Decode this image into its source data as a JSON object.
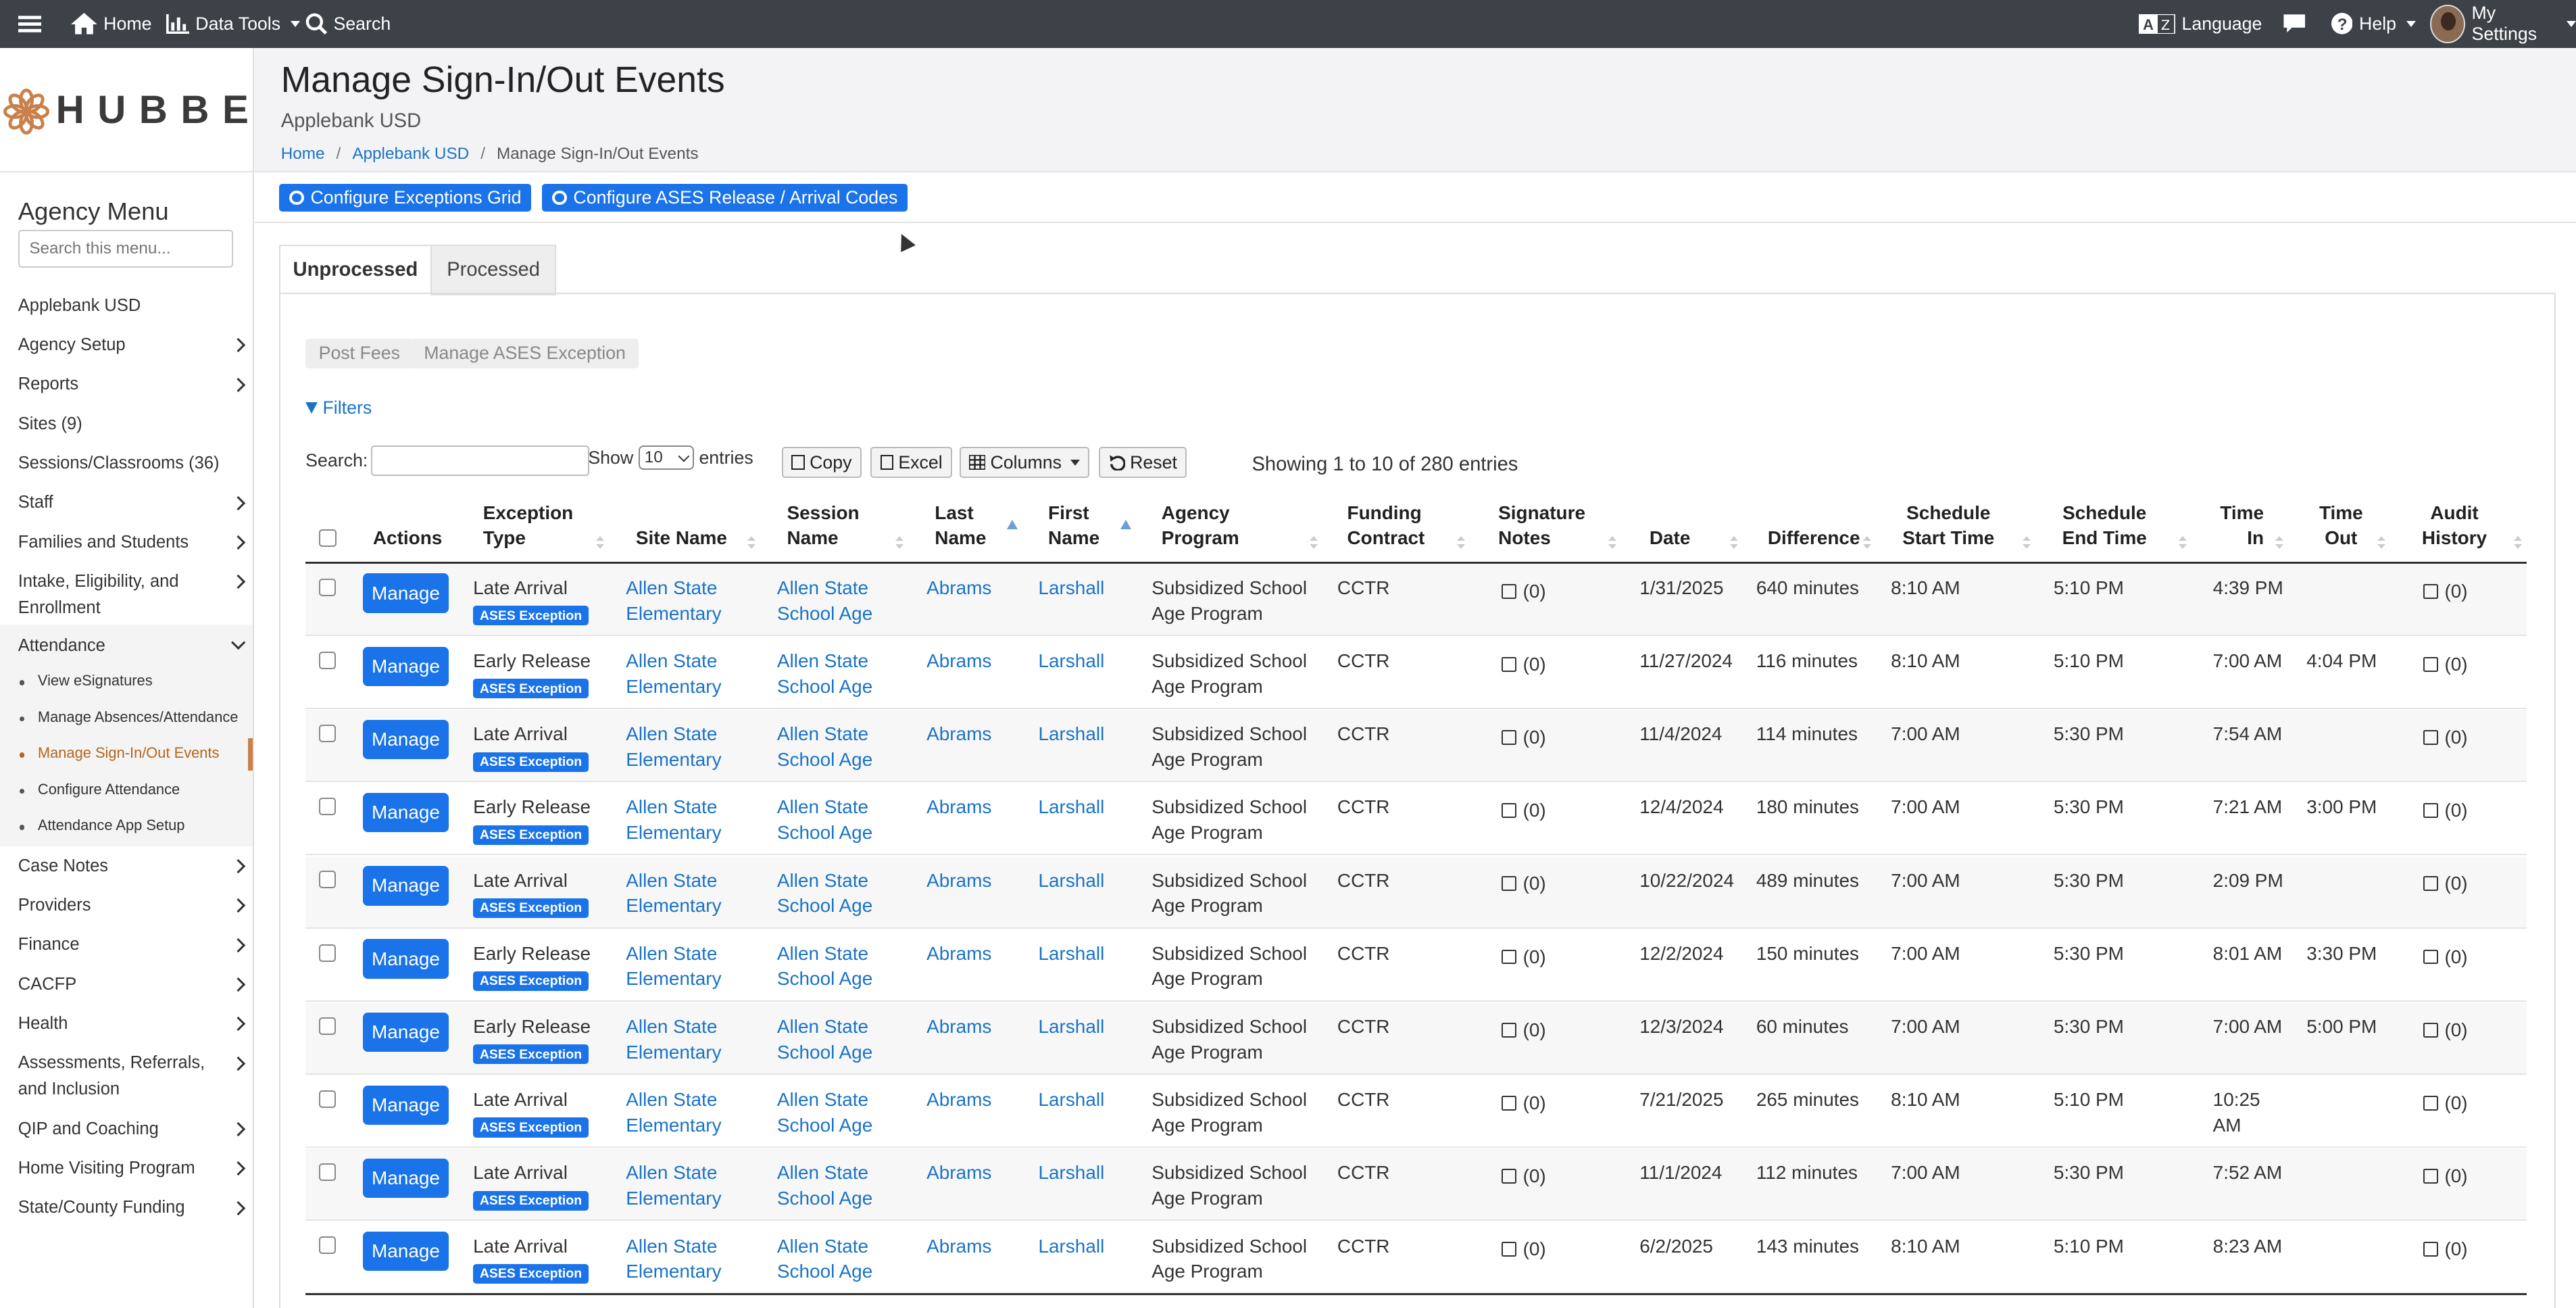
{
  "topnav": {
    "home": "Home",
    "data_tools": "Data Tools",
    "search": "Search",
    "language": "Language",
    "help": "Help",
    "settings": "My Settings"
  },
  "logo": "HUBBE",
  "sidebar": {
    "title": "Agency Menu",
    "search_placeholder": "Search this menu...",
    "items": [
      "Applebank USD",
      "Agency Setup",
      "Reports",
      "Sites (9)",
      "Sessions/Classrooms (36)",
      "Staff",
      "Families and Students",
      "Intake, Eligibility, and Enrollment",
      "Attendance",
      "Case Notes",
      "Providers",
      "Finance",
      "CACFP",
      "Health",
      "Assessments, Referrals, and Inclusion",
      "QIP and Coaching",
      "Home Visiting Program",
      "State/County Funding"
    ],
    "attendance_sub": [
      "View eSignatures",
      "Manage Absences/Attendance",
      "Manage Sign-In/Out Events",
      "Configure Attendance",
      "Attendance App Setup"
    ]
  },
  "page": {
    "title": "Manage Sign-In/Out Events",
    "subtitle": "Applebank USD",
    "breadcrumb": [
      "Home",
      "Applebank USD",
      "Manage Sign-In/Out Events"
    ],
    "btn_exceptions": "Configure Exceptions Grid",
    "btn_ases": "Configure ASES Release / Arrival Codes"
  },
  "tabs": [
    "Unprocessed",
    "Processed"
  ],
  "actions": {
    "post_fees": "Post Fees",
    "manage_ases": "Manage ASES Exception",
    "filters": "Filters"
  },
  "table_controls": {
    "search_label": "Search:",
    "show_label": "Show",
    "show_value": "10",
    "entries_label": "entries",
    "copy": "Copy",
    "excel": "Excel",
    "columns": "Columns",
    "reset": "Reset",
    "info": "Showing 1 to 10 of 280 entries"
  },
  "columns": [
    "Actions",
    "Exception Type",
    "Site Name",
    "Session Name",
    "Last Name",
    "First Name",
    "Agency Program",
    "Funding Contract",
    "Signature Notes",
    "Date",
    "Difference",
    "Schedule Start Time",
    "Schedule End Time",
    "Time In",
    "Time Out",
    "Audit History"
  ],
  "rows": [
    {
      "type": "Late Arrival",
      "badge": "ASES Exception",
      "site": [
        "Allen State",
        "Elementary"
      ],
      "session": [
        "Allen State",
        "School Age"
      ],
      "last": "Abrams",
      "first": "Larshall",
      "program": [
        "Subsidized School",
        "Age Program"
      ],
      "contract": "CCTR",
      "notes": "(0)",
      "date": "1/31/2025",
      "diff": "640 minutes",
      "start": "8:10 AM",
      "end": "5:10 PM",
      "in": "4:39 PM",
      "out": "",
      "audit": "(0)"
    },
    {
      "type": "Early Release",
      "badge": "ASES Exception",
      "site": [
        "Allen State",
        "Elementary"
      ],
      "session": [
        "Allen State",
        "School Age"
      ],
      "last": "Abrams",
      "first": "Larshall",
      "program": [
        "Subsidized School",
        "Age Program"
      ],
      "contract": "CCTR",
      "notes": "(0)",
      "date": "11/27/2024",
      "diff": "116 minutes",
      "start": "8:10 AM",
      "end": "5:10 PM",
      "in": "7:00 AM",
      "out": "4:04 PM",
      "audit": "(0)"
    },
    {
      "type": "Late Arrival",
      "badge": "ASES Exception",
      "site": [
        "Allen State",
        "Elementary"
      ],
      "session": [
        "Allen State",
        "School Age"
      ],
      "last": "Abrams",
      "first": "Larshall",
      "program": [
        "Subsidized School",
        "Age Program"
      ],
      "contract": "CCTR",
      "notes": "(0)",
      "date": "11/4/2024",
      "diff": "114 minutes",
      "start": "7:00 AM",
      "end": "5:30 PM",
      "in": "7:54 AM",
      "out": "",
      "audit": "(0)"
    },
    {
      "type": "Early Release",
      "badge": "ASES Exception",
      "site": [
        "Allen State",
        "Elementary"
      ],
      "session": [
        "Allen State",
        "School Age"
      ],
      "last": "Abrams",
      "first": "Larshall",
      "program": [
        "Subsidized School",
        "Age Program"
      ],
      "contract": "CCTR",
      "notes": "(0)",
      "date": "12/4/2024",
      "diff": "180 minutes",
      "start": "7:00 AM",
      "end": "5:30 PM",
      "in": "7:21 AM",
      "out": "3:00 PM",
      "audit": "(0)"
    },
    {
      "type": "Late Arrival",
      "badge": "ASES Exception",
      "site": [
        "Allen State",
        "Elementary"
      ],
      "session": [
        "Allen State",
        "School Age"
      ],
      "last": "Abrams",
      "first": "Larshall",
      "program": [
        "Subsidized School",
        "Age Program"
      ],
      "contract": "CCTR",
      "notes": "(0)",
      "date": "10/22/2024",
      "diff": "489 minutes",
      "start": "7:00 AM",
      "end": "5:30 PM",
      "in": "2:09 PM",
      "out": "",
      "audit": "(0)"
    },
    {
      "type": "Early Release",
      "badge": "ASES Exception",
      "site": [
        "Allen State",
        "Elementary"
      ],
      "session": [
        "Allen State",
        "School Age"
      ],
      "last": "Abrams",
      "first": "Larshall",
      "program": [
        "Subsidized School",
        "Age Program"
      ],
      "contract": "CCTR",
      "notes": "(0)",
      "date": "12/2/2024",
      "diff": "150 minutes",
      "start": "7:00 AM",
      "end": "5:30 PM",
      "in": "8:01 AM",
      "out": "3:30 PM",
      "audit": "(0)"
    },
    {
      "type": "Early Release",
      "badge": "ASES Exception",
      "site": [
        "Allen State",
        "Elementary"
      ],
      "session": [
        "Allen State",
        "School Age"
      ],
      "last": "Abrams",
      "first": "Larshall",
      "program": [
        "Subsidized School",
        "Age Program"
      ],
      "contract": "CCTR",
      "notes": "(0)",
      "date": "12/3/2024",
      "diff": "60 minutes",
      "start": "7:00 AM",
      "end": "5:30 PM",
      "in": "7:00 AM",
      "out": "5:00 PM",
      "audit": "(0)"
    },
    {
      "type": "Late Arrival",
      "badge": "ASES Exception",
      "site": [
        "Allen State",
        "Elementary"
      ],
      "session": [
        "Allen State",
        "School Age"
      ],
      "last": "Abrams",
      "first": "Larshall",
      "program": [
        "Subsidized School",
        "Age Program"
      ],
      "contract": "CCTR",
      "notes": "(0)",
      "date": "7/21/2025",
      "diff": "265 minutes",
      "start": "8:10 AM",
      "end": "5:10 PM",
      "in": "10:25 AM",
      "out": "",
      "audit": "(0)"
    },
    {
      "type": "Late Arrival",
      "badge": "ASES Exception",
      "site": [
        "Allen State",
        "Elementary"
      ],
      "session": [
        "Allen State",
        "School Age"
      ],
      "last": "Abrams",
      "first": "Larshall",
      "program": [
        "Subsidized School",
        "Age Program"
      ],
      "contract": "CCTR",
      "notes": "(0)",
      "date": "11/1/2024",
      "diff": "112 minutes",
      "start": "7:00 AM",
      "end": "5:30 PM",
      "in": "7:52 AM",
      "out": "",
      "audit": "(0)"
    },
    {
      "type": "Late Arrival",
      "badge": "ASES Exception",
      "site": [
        "Allen State",
        "Elementary"
      ],
      "session": [
        "Allen State",
        "School Age"
      ],
      "last": "Abrams",
      "first": "Larshall",
      "program": [
        "Subsidized School",
        "Age Program"
      ],
      "contract": "CCTR",
      "notes": "(0)",
      "date": "6/2/2025",
      "diff": "143 minutes",
      "start": "8:10 AM",
      "end": "5:10 PM",
      "in": "8:23 AM",
      "out": "",
      "audit": "(0)"
    }
  ],
  "manage_label": "Manage",
  "colors": {
    "nav_bg": "#3d4148",
    "primary": "#1a73e8",
    "link": "#1a73c8",
    "active_menu": "#b5651d"
  }
}
